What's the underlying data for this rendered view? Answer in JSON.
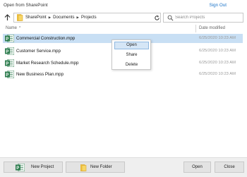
{
  "window": {
    "title": "Open from SharePoint",
    "sign_out": "Sign Out"
  },
  "nav": {
    "breadcrumbs": [
      "SharePoint",
      "Documents",
      "Projects"
    ],
    "search_placeholder": "Search Projects"
  },
  "list": {
    "columns": {
      "name": "Name",
      "date": "Date modified"
    },
    "rows": [
      {
        "name": "Commercial Construction.mpp",
        "date": "6/25/2020 10:23 AM",
        "selected": true
      },
      {
        "name": "Customer Service.mpp",
        "date": "6/25/2020 10:23 AM",
        "selected": false
      },
      {
        "name": "Market Research Schedule.mpp",
        "date": "6/25/2020 10:23 AM",
        "selected": false
      },
      {
        "name": "New Business Plan.mpp",
        "date": "6/25/2020 10:23 AM",
        "selected": false
      }
    ]
  },
  "context_menu": {
    "items": [
      "Open",
      "Share",
      "Delete"
    ]
  },
  "footer": {
    "new_project": "New Project",
    "new_folder": "New Folder",
    "open": "Open",
    "close": "Close"
  },
  "colors": {
    "accent_link": "#1a73c8",
    "selection": "#c8dff4",
    "project_icon": "#2e7d4f",
    "folder": "#f2c744"
  },
  "icons": {
    "up": "arrow-up-icon",
    "folder": "folder-icon",
    "refresh": "refresh-icon",
    "search": "search-icon",
    "project_file": "project-file-icon"
  }
}
